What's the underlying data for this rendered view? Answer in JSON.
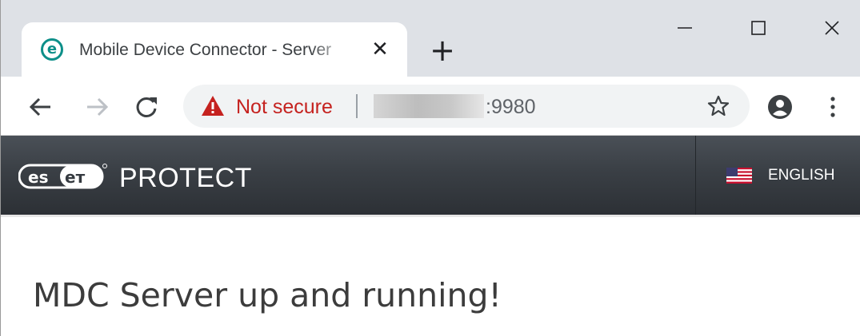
{
  "browser": {
    "tab": {
      "title": "Mobile Device Connector - Server",
      "favicon": "eset-e-icon",
      "close_icon": "close-icon"
    },
    "new_tab_icon": "plus-icon",
    "window_controls": [
      "minimize-icon",
      "maximize-icon",
      "close-icon"
    ],
    "toolbar": {
      "back_icon": "arrow-left-icon",
      "forward_icon": "arrow-right-icon",
      "reload_icon": "reload-icon",
      "address": {
        "security_icon": "warning-triangle-icon",
        "security_label": "Not secure",
        "port": ":9980"
      },
      "bookmark_icon": "star-icon",
      "profile_icon": "account-icon",
      "menu_icon": "vertical-dots-icon"
    }
  },
  "app": {
    "logo_text": "eset",
    "product_name": "PROTECT",
    "language": {
      "flag_icon": "us-flag-icon",
      "label": "ENGLISH"
    },
    "message": "MDC Server up and running!"
  },
  "colors": {
    "tabstrip_bg": "#dee1e6",
    "omnibox_bg": "#f1f3f4",
    "warning_red": "#c5221f",
    "header_dark": "#3a3f45",
    "eset_teal": "#0d8f89"
  }
}
